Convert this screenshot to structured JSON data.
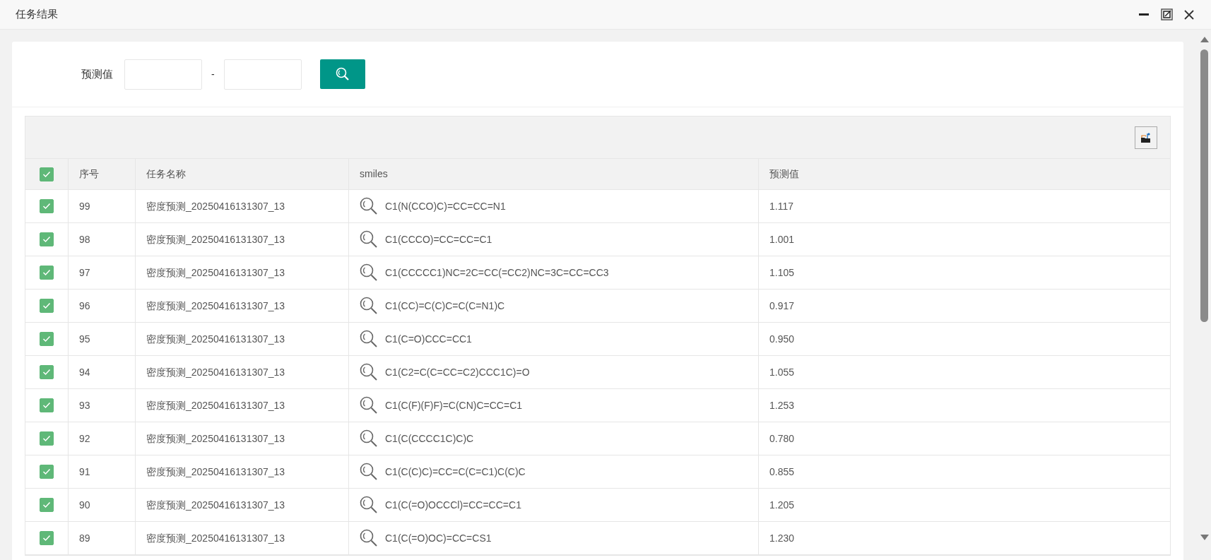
{
  "window": {
    "title": "任务结果"
  },
  "filter": {
    "label": "预测值",
    "separator": "-"
  },
  "table": {
    "all_checked": true,
    "columns": [
      "序号",
      "任务名称",
      "smiles",
      "预测值"
    ],
    "rows": [
      {
        "checked": true,
        "index": "99",
        "task": "密度预测_20250416131307_13",
        "smiles": "C1(N(CCO)C)=CC=CC=N1",
        "value": "1.117"
      },
      {
        "checked": true,
        "index": "98",
        "task": "密度预测_20250416131307_13",
        "smiles": "C1(CCCO)=CC=CC=C1",
        "value": "1.001"
      },
      {
        "checked": true,
        "index": "97",
        "task": "密度预测_20250416131307_13",
        "smiles": "C1(CCCCC1)NC=2C=CC(=CC2)NC=3C=CC=CC3",
        "value": "1.105"
      },
      {
        "checked": true,
        "index": "96",
        "task": "密度预测_20250416131307_13",
        "smiles": "C1(CC)=C(C)C=C(C=N1)C",
        "value": "0.917"
      },
      {
        "checked": true,
        "index": "95",
        "task": "密度预测_20250416131307_13",
        "smiles": "C1(C=O)CCC=CC1",
        "value": "0.950"
      },
      {
        "checked": true,
        "index": "94",
        "task": "密度预测_20250416131307_13",
        "smiles": "C1(C2=C(C=CC=C2)CCC1C)=O",
        "value": "1.055"
      },
      {
        "checked": true,
        "index": "93",
        "task": "密度预测_20250416131307_13",
        "smiles": "C1(C(F)(F)F)=C(CN)C=CC=C1",
        "value": "1.253"
      },
      {
        "checked": true,
        "index": "92",
        "task": "密度预测_20250416131307_13",
        "smiles": "C1(C(CCCC1C)C)C",
        "value": "0.780"
      },
      {
        "checked": true,
        "index": "91",
        "task": "密度预测_20250416131307_13",
        "smiles": "C1(C(C)C)=CC=C(C=C1)C(C)C",
        "value": "0.855"
      },
      {
        "checked": true,
        "index": "90",
        "task": "密度预测_20250416131307_13",
        "smiles": "C1(C(=O)OCCCl)=CC=CC=C1",
        "value": "1.205"
      },
      {
        "checked": true,
        "index": "89",
        "task": "密度预测_20250416131307_13",
        "smiles": "C1(C(=O)OC)=CC=CS1",
        "value": "1.230"
      }
    ]
  }
}
